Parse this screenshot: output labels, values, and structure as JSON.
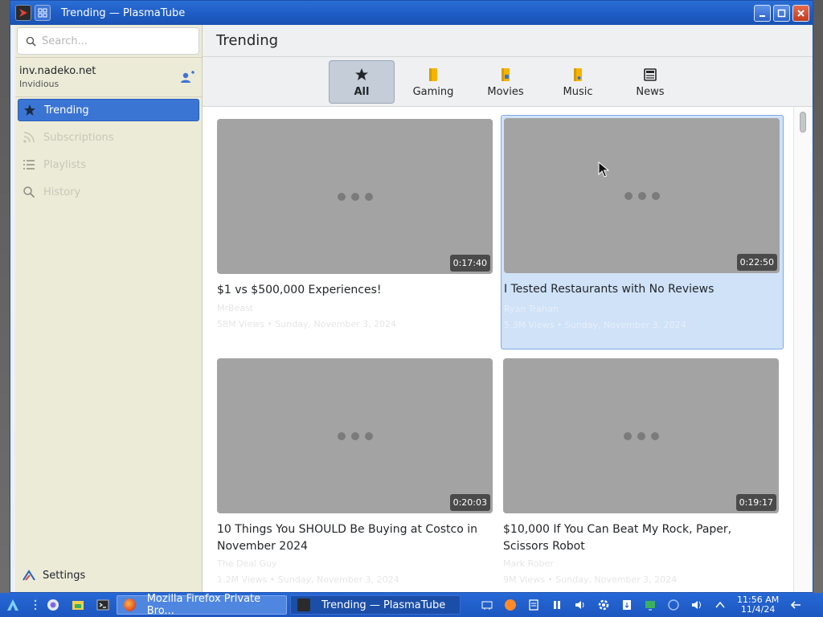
{
  "window": {
    "title": "Trending — PlasmaTube"
  },
  "sidebar": {
    "search_placeholder": "Search...",
    "account": {
      "host": "inv.nadeko.net",
      "kind": "Invidious"
    },
    "nav": [
      {
        "label": "Trending",
        "icon": "star-icon",
        "active": true
      },
      {
        "label": "Subscriptions",
        "icon": "rss-icon",
        "active": false
      },
      {
        "label": "Playlists",
        "icon": "list-icon",
        "active": false
      },
      {
        "label": "History",
        "icon": "search-icon",
        "active": false
      }
    ],
    "settings_label": "Settings"
  },
  "main": {
    "page_title": "Trending",
    "categories": [
      {
        "label": "All",
        "icon": "star-icon",
        "active": true
      },
      {
        "label": "Gaming",
        "icon": "folder-icon",
        "active": false
      },
      {
        "label": "Movies",
        "icon": "folder-icon",
        "active": false
      },
      {
        "label": "Music",
        "icon": "folder-icon",
        "active": false
      },
      {
        "label": "News",
        "icon": "newspaper-icon",
        "active": false
      }
    ],
    "videos": [
      {
        "title": "$1 vs $500,000 Experiences!",
        "duration": "0:17:40",
        "channel": "MrBeast",
        "meta": "58M Views • Sunday, November 3, 2024",
        "selected": false
      },
      {
        "title": "I Tested Restaurants with No Reviews",
        "duration": "0:22:50",
        "channel": "Ryan Trahan",
        "meta": "5.3M Views • Sunday, November 3, 2024",
        "selected": true
      },
      {
        "title": "10 Things You SHOULD Be Buying at Costco in November 2024",
        "duration": "0:20:03",
        "channel": "The Deal Guy",
        "meta": "1.2M Views • Sunday, November 3, 2024",
        "selected": false
      },
      {
        "title": "$10,000 If You Can Beat My Rock, Paper, Scissors Robot",
        "duration": "0:19:17",
        "channel": "Mark Rober",
        "meta": "9M Views • Sunday, November 3, 2024",
        "selected": false
      }
    ]
  },
  "taskbar": {
    "tasks": [
      {
        "label": "Mozilla Firefox Private Bro...",
        "icon": "firefox-icon"
      },
      {
        "label": "Trending — PlasmaTube",
        "icon": "plasmatube-icon"
      }
    ],
    "clock": {
      "time": "11:56 AM",
      "date": "11/4/24"
    }
  }
}
